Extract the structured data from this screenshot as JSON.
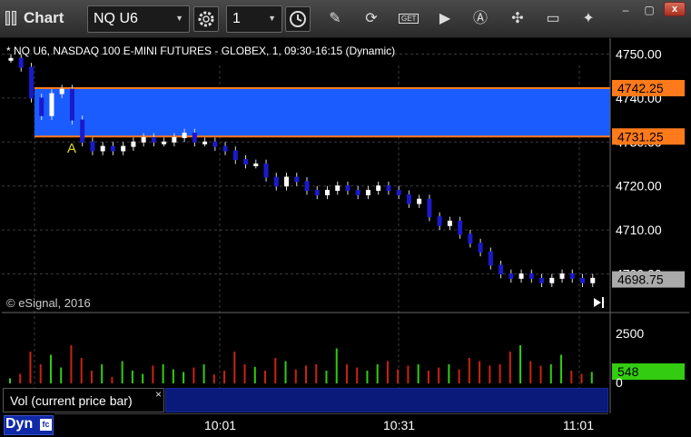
{
  "app": {
    "title": "Chart",
    "close": "x"
  },
  "toolbar": {
    "symbol": "NQ U6",
    "interval": "1",
    "icons": [
      "gear-icon",
      "clock-icon",
      "pencil-icon",
      "refresh-icon",
      "get-icon",
      "play-icon",
      "alert-icon",
      "tools-icon",
      "comment-icon",
      "twitter-icon"
    ]
  },
  "chart": {
    "header": "* NQ U6, NASDAQ 100 E-MINI FUTURES - GLOBEX, 1, 09:30-16:15 (Dynamic)",
    "copyright": "© eSignal, 2016",
    "price_labels": [
      "4750.00",
      "4740.00",
      "4730.00",
      "4720.00",
      "4710.00",
      "4700.00"
    ],
    "price_values": [
      4750,
      4740,
      4730,
      4720,
      4710,
      4700
    ],
    "band_high_label": "4742.25",
    "band_low_label": "4731.25",
    "band_high": 4742.25,
    "band_low": 4731.25,
    "last_price_label": "4698.75",
    "last_price": 4698.75,
    "annotation": "A",
    "band_color": "#1a5cff",
    "band_edge_color": "#ff7a1a",
    "up_color": "#ffffff",
    "down_color": "#1a1acc"
  },
  "volume": {
    "legend": "Vol (current price bar)",
    "legend_close": "×",
    "axis_labels": [
      "2500",
      "0"
    ],
    "current_label": "548",
    "current_color": "#33cc11"
  },
  "time_axis": {
    "labels": [
      "10:01",
      "10:31",
      "11:01"
    ]
  },
  "status": {
    "dyn": "Dyn"
  }
}
